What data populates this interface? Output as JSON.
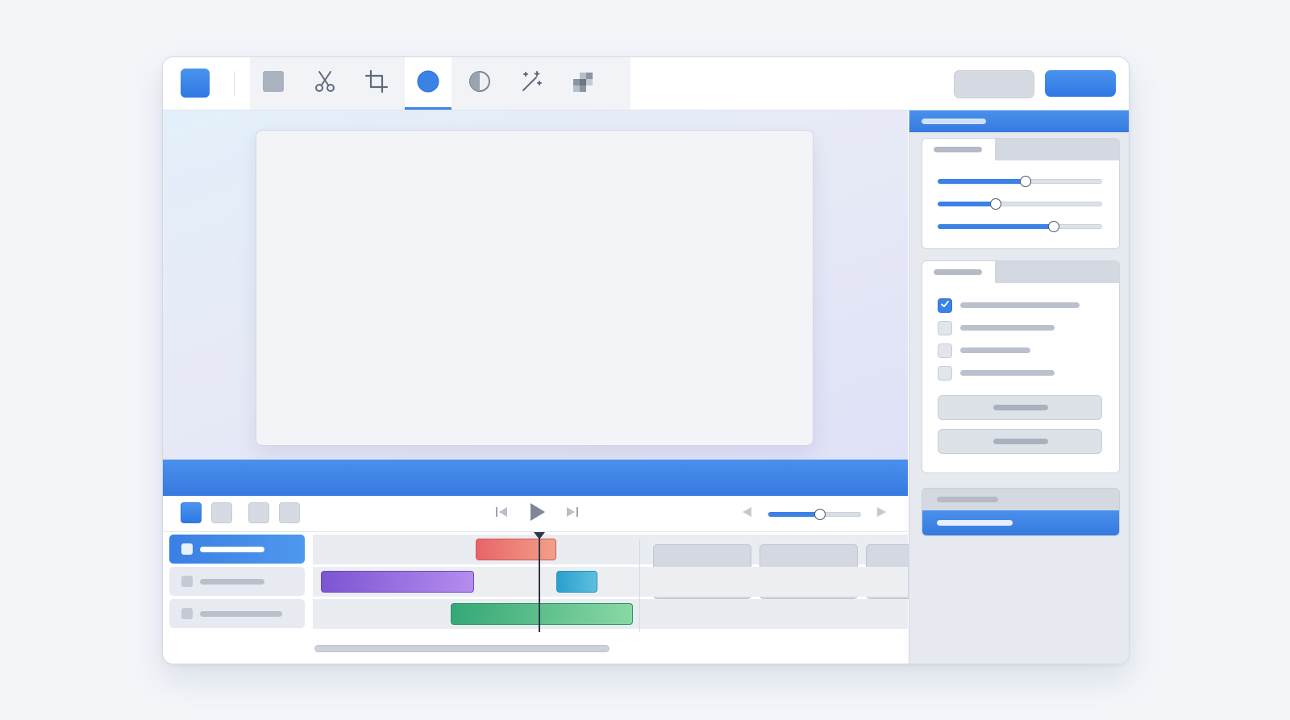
{
  "window": {
    "title": ""
  },
  "toolbar": {
    "tools": [
      {
        "name": "select-tool",
        "icon": "square-icon"
      },
      {
        "name": "cut-tool",
        "icon": "scissors-icon"
      },
      {
        "name": "crop-tool",
        "icon": "crop-icon"
      },
      {
        "name": "color-tool",
        "icon": "circle-icon",
        "active": true
      },
      {
        "name": "contrast-tool",
        "icon": "contrast-icon"
      },
      {
        "name": "magic-tool",
        "icon": "magic-wand-icon"
      },
      {
        "name": "mosaic-tool",
        "icon": "pixelate-icon"
      }
    ],
    "secondary_label": "",
    "primary_label": ""
  },
  "transport": {
    "volume_level": 0.55
  },
  "timeline": {
    "tracks": [
      {
        "label": "",
        "selected": true
      },
      {
        "label": "",
        "selected": false
      },
      {
        "label": "",
        "selected": false
      }
    ],
    "playhead_position": 0.5
  },
  "inspector": {
    "title": "",
    "adjustments": {
      "tab_label": "",
      "slider_values": [
        0.53,
        0.35,
        0.7
      ]
    },
    "options": {
      "tab_label": "",
      "checkboxes": [
        {
          "label": "",
          "checked": true
        },
        {
          "label": "",
          "checked": false
        },
        {
          "label": "",
          "checked": false
        },
        {
          "label": "",
          "checked": false
        }
      ],
      "button_1_label": "",
      "button_2_label": ""
    },
    "layers": {
      "header_label": "",
      "selected_item_label": ""
    }
  },
  "colors": {
    "accent": "#3b82e6",
    "clip_red": "#e8646a",
    "clip_purple": "#7c55d3",
    "clip_teal": "#2a9fcf",
    "clip_green": "#34a876"
  }
}
